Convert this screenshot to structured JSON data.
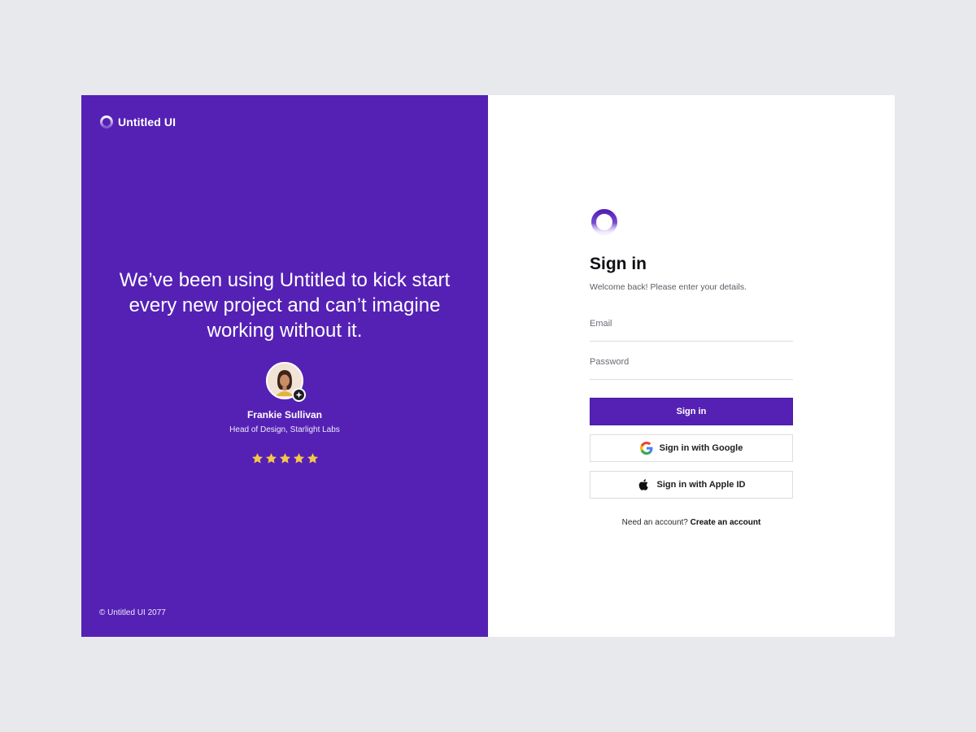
{
  "brand": {
    "name": "Untitled UI",
    "logo_icon": "ring-logo-icon"
  },
  "testimonial": {
    "quote": "We’ve been using Untitled to kick start every new project and can’t imagine working without it.",
    "author_name": "Frankie Sullivan",
    "author_role": "Head of Design, Starlight Labs",
    "rating": 5,
    "rating_max": 5
  },
  "footer": {
    "copyright": "© Untitled UI 2077"
  },
  "signin": {
    "title": "Sign in",
    "subtitle": "Welcome back! Please enter your details.",
    "email_placeholder": "Email",
    "email_value": "",
    "password_placeholder": "Password",
    "password_value": "",
    "submit_label": "Sign in",
    "google_label": "Sign in with Google",
    "apple_label": "Sign in with Apple ID",
    "signup_prompt": "Need an account?",
    "signup_link": "Create an account"
  },
  "colors": {
    "brand_purple": "#5521b5",
    "page_background": "#e8e9ed",
    "star_yellow": "#f4c84a",
    "text_dark": "#101014"
  }
}
